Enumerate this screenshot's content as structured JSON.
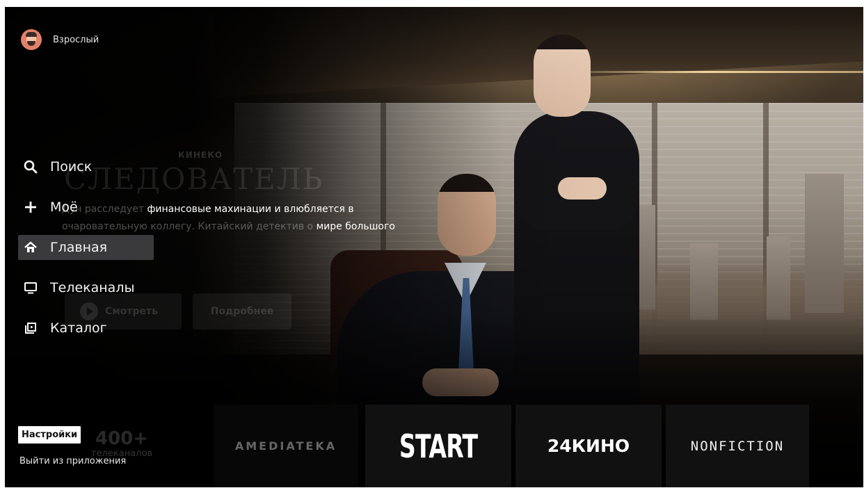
{
  "profile": {
    "name": "Взрослый",
    "icon": "avatar-icon"
  },
  "nav": {
    "items": [
      {
        "label": "Поиск",
        "icon": "search-icon"
      },
      {
        "label": "Моё",
        "icon": "plus-icon"
      },
      {
        "label": "Главная",
        "icon": "home-icon",
        "active": true
      },
      {
        "label": "Телеканалы",
        "icon": "tv-icon"
      },
      {
        "label": "Каталог",
        "icon": "catalog-icon"
      }
    ]
  },
  "hero": {
    "provider": "КИНЕКО",
    "title": "СЛЕДОВАТЕЛЬ",
    "description_dim1": "Дун расследует ",
    "description_bright1": "финансовые махинации и влюбляется в",
    "description_dim2": "очаровательную коллегу. Китайский детектив о ",
    "description_bright2": "мире большого",
    "watch_label": "Смотреть",
    "more_label": "Подробнее"
  },
  "channels_counter": {
    "number": "400+",
    "label": "телеканалов"
  },
  "partners": {
    "amediateka": "AMEDIATEKA",
    "start": "START",
    "kino24": "24КИНО",
    "nonfiction": "NONFICTION"
  },
  "footer": {
    "settings_label": "Настройки",
    "exit_label": "Выйти из приложения"
  },
  "colors": {
    "active_nav_bg": "#3a3a3c",
    "avatar_bg": "#e2816a",
    "background": "#000000"
  }
}
